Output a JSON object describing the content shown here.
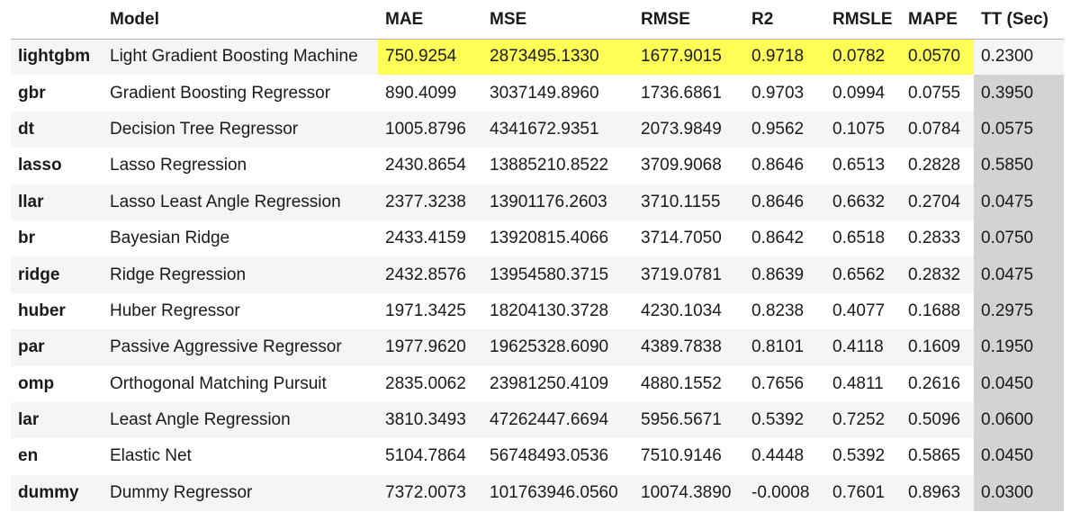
{
  "table": {
    "columns": {
      "index": "",
      "model": "Model",
      "mae": "MAE",
      "mse": "MSE",
      "rmse": "RMSE",
      "r2": "R2",
      "rmsle": "RMSLE",
      "mape": "MAPE",
      "tt": "TT (Sec)"
    },
    "rows": [
      {
        "id": "lightgbm",
        "model": "Light Gradient Boosting Machine",
        "mae": "750.9254",
        "mse": "2873495.1330",
        "rmse": "1677.9015",
        "r2": "0.9718",
        "rmsle": "0.0782",
        "mape": "0.0570",
        "tt": "0.2300"
      },
      {
        "id": "gbr",
        "model": "Gradient Boosting Regressor",
        "mae": "890.4099",
        "mse": "3037149.8960",
        "rmse": "1736.6861",
        "r2": "0.9703",
        "rmsle": "0.0994",
        "mape": "0.0755",
        "tt": "0.3950"
      },
      {
        "id": "dt",
        "model": "Decision Tree Regressor",
        "mae": "1005.8796",
        "mse": "4341672.9351",
        "rmse": "2073.9849",
        "r2": "0.9562",
        "rmsle": "0.1075",
        "mape": "0.0784",
        "tt": "0.0575"
      },
      {
        "id": "lasso",
        "model": "Lasso Regression",
        "mae": "2430.8654",
        "mse": "13885210.8522",
        "rmse": "3709.9068",
        "r2": "0.8646",
        "rmsle": "0.6513",
        "mape": "0.2828",
        "tt": "0.5850"
      },
      {
        "id": "llar",
        "model": "Lasso Least Angle Regression",
        "mae": "2377.3238",
        "mse": "13901176.2603",
        "rmse": "3710.1155",
        "r2": "0.8646",
        "rmsle": "0.6632",
        "mape": "0.2704",
        "tt": "0.0475"
      },
      {
        "id": "br",
        "model": "Bayesian Ridge",
        "mae": "2433.4159",
        "mse": "13920815.4066",
        "rmse": "3714.7050",
        "r2": "0.8642",
        "rmsle": "0.6518",
        "mape": "0.2833",
        "tt": "0.0750"
      },
      {
        "id": "ridge",
        "model": "Ridge Regression",
        "mae": "2432.8576",
        "mse": "13954580.3715",
        "rmse": "3719.0781",
        "r2": "0.8639",
        "rmsle": "0.6562",
        "mape": "0.2832",
        "tt": "0.0475"
      },
      {
        "id": "huber",
        "model": "Huber Regressor",
        "mae": "1971.3425",
        "mse": "18204130.3728",
        "rmse": "4230.1034",
        "r2": "0.8238",
        "rmsle": "0.4077",
        "mape": "0.1688",
        "tt": "0.2975"
      },
      {
        "id": "par",
        "model": "Passive Aggressive Regressor",
        "mae": "1977.9620",
        "mse": "19625328.6090",
        "rmse": "4389.7838",
        "r2": "0.8101",
        "rmsle": "0.4118",
        "mape": "0.1609",
        "tt": "0.1950"
      },
      {
        "id": "omp",
        "model": "Orthogonal Matching Pursuit",
        "mae": "2835.0062",
        "mse": "23981250.4109",
        "rmse": "4880.1552",
        "r2": "0.7656",
        "rmsle": "0.4811",
        "mape": "0.2616",
        "tt": "0.0450"
      },
      {
        "id": "lar",
        "model": "Least Angle Regression",
        "mae": "3810.3493",
        "mse": "47262447.6694",
        "rmse": "5956.5671",
        "r2": "0.5392",
        "rmsle": "0.7252",
        "mape": "0.5096",
        "tt": "0.0600"
      },
      {
        "id": "en",
        "model": "Elastic Net",
        "mae": "5104.7864",
        "mse": "56748493.0536",
        "rmse": "7510.9146",
        "r2": "0.4448",
        "rmsle": "0.5392",
        "mape": "0.5865",
        "tt": "0.0450"
      },
      {
        "id": "dummy",
        "model": "Dummy Regressor",
        "mae": "7372.0073",
        "mse": "101763946.0560",
        "rmse": "10074.3890",
        "r2": "-0.0008",
        "rmsle": "0.7601",
        "mape": "0.8963",
        "tt": "0.0300"
      }
    ]
  },
  "colors": {
    "highlight_best": "#ffff55",
    "tt_column": "#d3d3d3",
    "row_stripe": "#f5f5f5"
  }
}
